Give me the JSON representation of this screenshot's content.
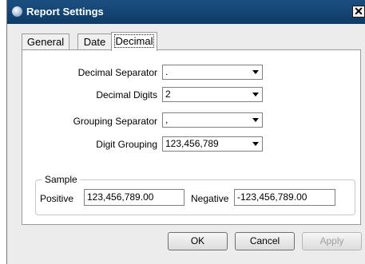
{
  "window": {
    "title": "Report Settings",
    "close_glyph": "✕"
  },
  "tabs": [
    {
      "label": "General"
    },
    {
      "label": "Date"
    },
    {
      "label": "Decimal"
    }
  ],
  "settings": {
    "decimal_separator": {
      "label": "Decimal Separator",
      "value": "."
    },
    "decimal_digits": {
      "label": "Decimal Digits",
      "value": "2"
    },
    "grouping_separator": {
      "label": "Grouping Separator",
      "value": ","
    },
    "digit_grouping": {
      "label": "Digit Grouping",
      "value": "123,456,789"
    }
  },
  "sample": {
    "legend": "Sample",
    "positive_label": "Positive",
    "positive_value": "123,456,789.00",
    "negative_label": "Negative",
    "negative_value": "-123,456,789.00"
  },
  "buttons": {
    "ok": "OK",
    "cancel": "Cancel",
    "apply": "Apply"
  }
}
